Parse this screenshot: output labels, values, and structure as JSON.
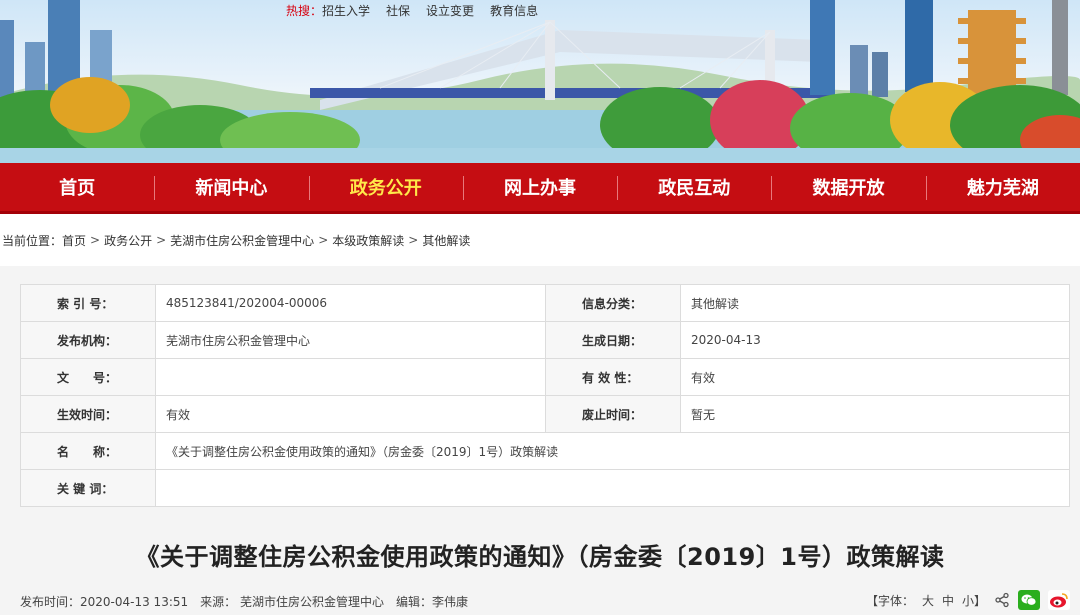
{
  "hot_links": {
    "label": "热搜：",
    "items": [
      "招生入学",
      "社保",
      "设立变更",
      "教育信息"
    ]
  },
  "nav": {
    "items": [
      "首页",
      "新闻中心",
      "政务公开",
      "网上办事",
      "政民互动",
      "数据开放",
      "魅力芜湖"
    ],
    "active_index": 2
  },
  "breadcrumb": {
    "prefix": "当前位置：",
    "items": [
      "首页",
      "政务公开",
      "芜湖市住房公积金管理中心",
      "本级政策解读",
      "其他解读"
    ]
  },
  "info": {
    "index_label": "索 引 号：",
    "index_value": "485123841/202004-00006",
    "category_label": "信息分类：",
    "category_value": "其他解读",
    "publisher_label": "发布机构：",
    "publisher_value": "芜湖市住房公积金管理中心",
    "created_label": "生成日期：",
    "created_value": "2020-04-13",
    "doc_no_label": "文　　号：",
    "doc_no_value": "",
    "validity_label": "有 效 性：",
    "validity_value": "有效",
    "effective_label": "生效时间：",
    "effective_value": "有效",
    "abolish_label": "废止时间：",
    "abolish_value": "暂无",
    "name_label": "名　　称：",
    "name_value": "《关于调整住房公积金使用政策的通知》（房金委〔2019〕1号）政策解读",
    "keywords_label": "关 键 词：",
    "keywords_value": ""
  },
  "article": {
    "title": "《关于调整住房公积金使用政策的通知》（房金委〔2019〕1号）政策解读",
    "published": "发布时间：2020-04-13 13:51",
    "source": "来源：  芜湖市住房公积金管理中心",
    "editor": "编辑：李伟康",
    "font_label": "【字体：",
    "font_large": "大",
    "font_medium": "中",
    "font_small": "小】"
  },
  "colors": {
    "nav_red": "#c50d12",
    "active_nav": "#ffe84a",
    "hot_red": "#d7000f"
  }
}
